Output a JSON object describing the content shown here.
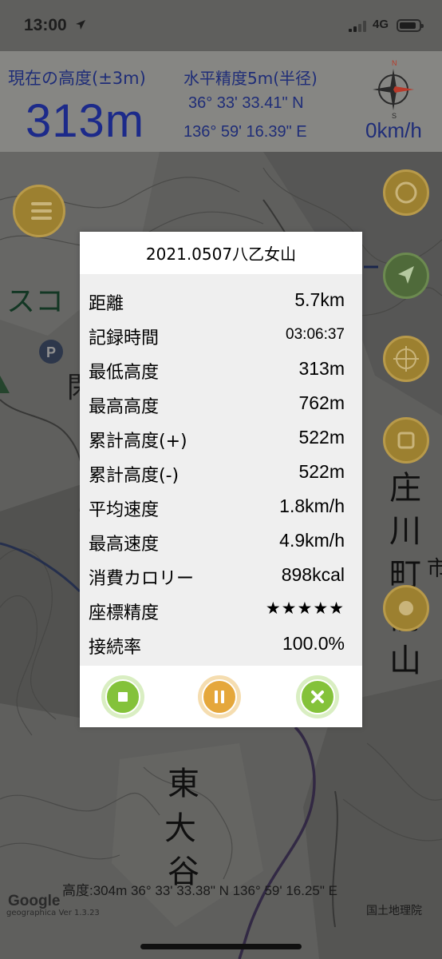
{
  "status_bar": {
    "time": "13:00",
    "network": "4G",
    "battery_level": 0.85
  },
  "gps_header": {
    "altitude_label": "現在の高度(±3m)",
    "altitude_value": "313m",
    "accuracy_label": "水平精度5m(半径)",
    "latitude": "36° 33' 33.41\" N",
    "longitude": "136° 59' 16.39\" E",
    "speed": "0km/h",
    "compass_letters": {
      "n": "N",
      "s": "S"
    }
  },
  "map": {
    "labels": {
      "sukoa": "スコ",
      "parking": "P",
      "kan": "閑",
      "sho": "庄",
      "kawa": "川",
      "machi": "町",
      "mae": "前",
      "yama": "山",
      "higashi": "東",
      "dai": "大",
      "tani": "谷",
      "edge": "市"
    }
  },
  "modal": {
    "title": "2021.0507八乙女山",
    "stats": [
      {
        "label": "距離",
        "value": "5.7km"
      },
      {
        "label": "記録時間",
        "value": "03:06:37"
      },
      {
        "label": "最低高度",
        "value": "313m"
      },
      {
        "label": "最高高度",
        "value": "762m"
      },
      {
        "label": "累計高度(+)",
        "value": "522m"
      },
      {
        "label": "累計高度(-)",
        "value": "522m"
      },
      {
        "label": "平均速度",
        "value": "1.8km/h"
      },
      {
        "label": "最高速度",
        "value": "4.9km/h"
      },
      {
        "label": "消費カロリー",
        "value": "898kcal"
      },
      {
        "label": "座標精度",
        "value": "★★★★★"
      },
      {
        "label": "接続率",
        "value": "100.0%"
      }
    ],
    "actions": {
      "stop_icon": "stop-icon",
      "pause_icon": "pause-icon",
      "close_icon": "close-icon"
    }
  },
  "bottom": {
    "google_logo": "Google",
    "geographica_version": "geographica Ver 1.3.23",
    "cursor_readout": "高度:304m  36° 33' 33.38\" N 136° 59' 16.25\" E",
    "map_credit": "国土地理院"
  },
  "colors": {
    "header_text": "#1f2d78",
    "stop_button": "#84c23a",
    "pause_button": "#e5a73b",
    "close_button": "#84c23a",
    "menu_button": "#9c8030"
  }
}
